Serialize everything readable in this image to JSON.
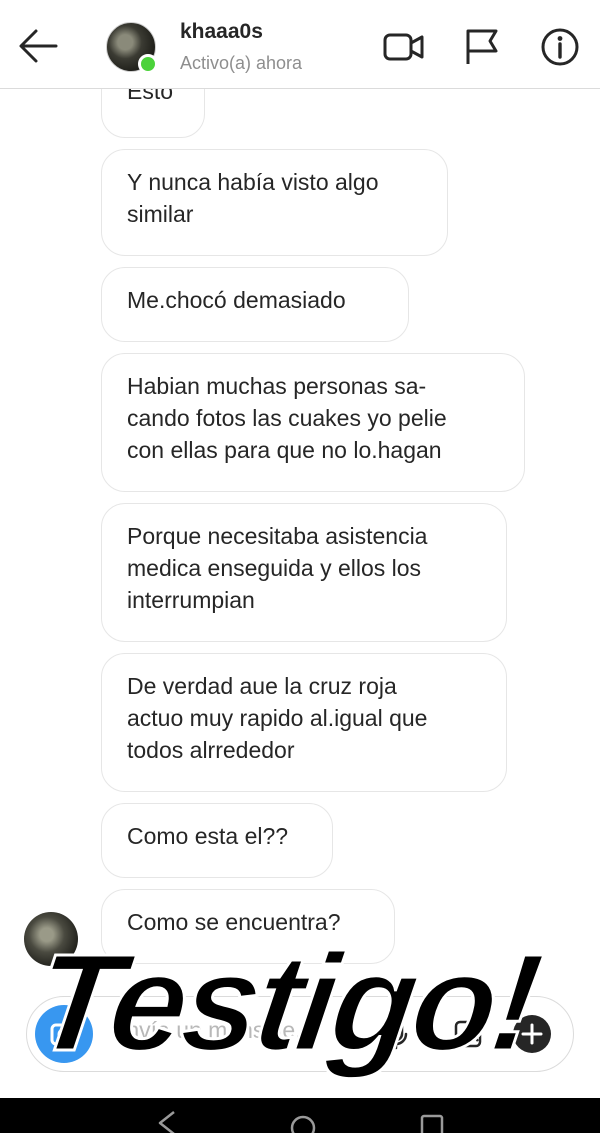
{
  "header": {
    "username": "khaaa0s",
    "status": "Activo(a) ahora",
    "icons": [
      "back-arrow-icon",
      "video-call-icon",
      "flag-icon",
      "info-icon"
    ]
  },
  "messages": [
    {
      "text": "Esto"
    },
    {
      "text": "Y nunca había visto algo\nsimilar"
    },
    {
      "text": "Me.chocó demasiado"
    },
    {
      "text": "Habian muchas personas sa-\ncando fotos las cuakes yo pelie\ncon ellas para que no lo.hagan"
    },
    {
      "text": "Porque necesitaba asistencia\nmedica enseguida y ellos los\ninterrumpian"
    },
    {
      "text": "De verdad aue la cruz roja\nactuo muy rapido al.igual que\ntodos alrrededor"
    },
    {
      "text": "Como esta el??"
    },
    {
      "text": "Como se encuentra?"
    }
  ],
  "composer": {
    "placeholder": "Envía un mensaje...",
    "icons": [
      "camera-icon",
      "microphone-icon",
      "gallery-icon",
      "add-icon"
    ]
  },
  "overlay": {
    "sticker_text": "Testigo!"
  },
  "colors": {
    "active": "#4bd23a",
    "camera": "#3897f0",
    "bubble_border": "#e6e6e6",
    "nav_bar": "#000000"
  }
}
